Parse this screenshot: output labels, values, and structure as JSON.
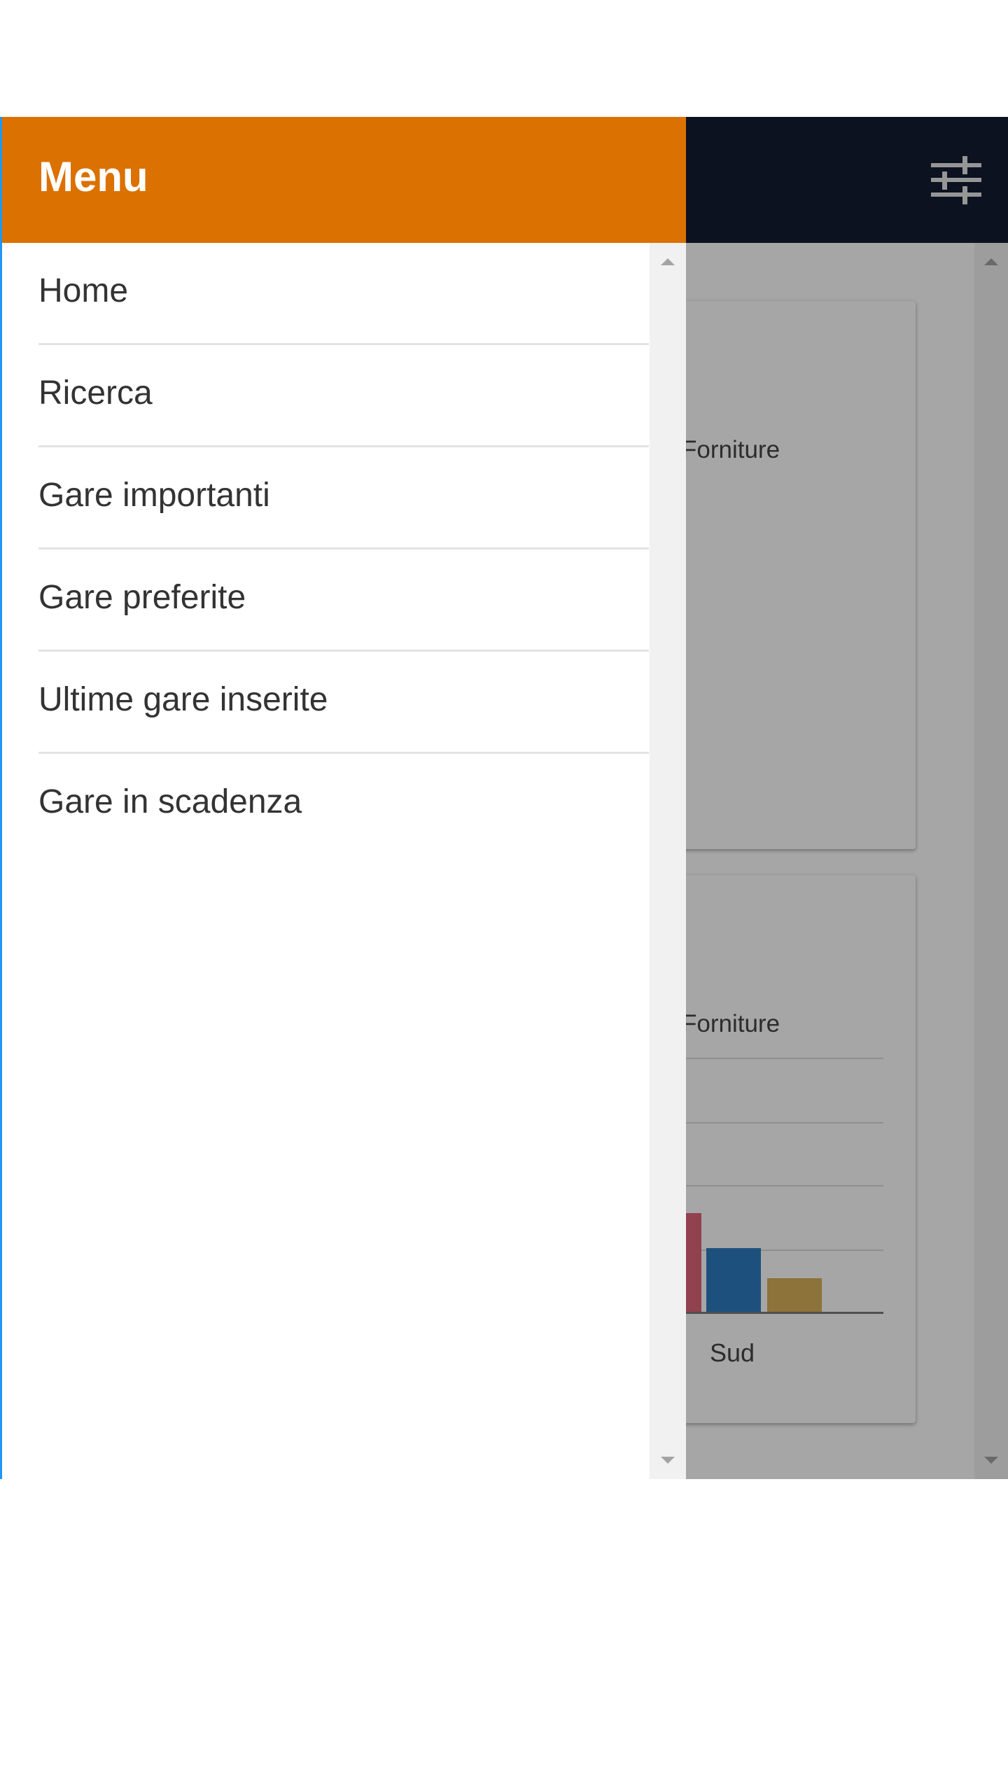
{
  "app": {
    "header": {
      "filter_icon": "sliders-icon"
    },
    "cards": [
      {
        "legend_label": "Forniture"
      },
      {
        "legend_label": "Forniture",
        "category_label": "Sud"
      }
    ]
  },
  "drawer": {
    "title": "Menu",
    "items": [
      {
        "label": "Home"
      },
      {
        "label": "Ricerca"
      },
      {
        "label": "Gare importanti"
      },
      {
        "label": "Gare preferite"
      },
      {
        "label": "Ultime gare inserite"
      },
      {
        "label": "Gare in scadenza"
      }
    ]
  },
  "colors": {
    "drawer_header": "#db7100",
    "app_header": "#141d33",
    "bar_red": "#e0647a",
    "bar_blue": "#2e7cc0",
    "bar_gold": "#d9b05a"
  }
}
